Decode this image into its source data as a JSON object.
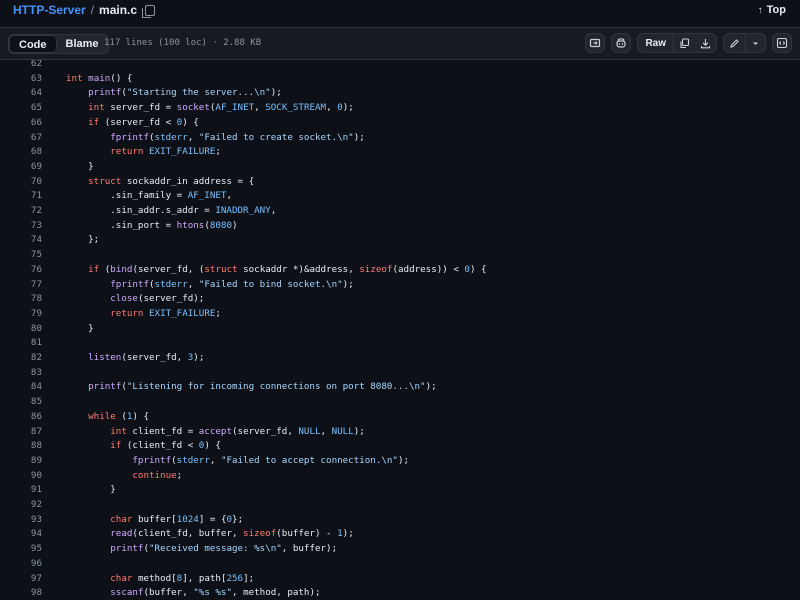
{
  "breadcrumb": {
    "repo": "HTTP-Server",
    "separator": "/",
    "file": "main.c"
  },
  "top_link": "Top",
  "toolbar": {
    "tabs": [
      "Code",
      "Blame"
    ],
    "meta": "117 lines (100 loc) · 2.88 KB",
    "raw_label": "Raw"
  },
  "icons": [
    "copy-icon",
    "arrow-up-icon",
    "open-in-icon",
    "copilot-icon",
    "copy-raw-icon",
    "download-icon",
    "pencil-icon",
    "chevron-down-icon",
    "symbols-panel-icon"
  ],
  "colors": {
    "background": "#0d1117",
    "keyword": "#ff7b72",
    "function": "#d2a8ff",
    "string": "#a5d6ff",
    "constant": "#79c0ff",
    "line_number": "#8b949e",
    "link": "#4493f8"
  },
  "code": {
    "lines": [
      {
        "n": "62",
        "t": ""
      },
      {
        "n": "63",
        "t": "int main() {"
      },
      {
        "n": "64",
        "t": "    printf(\"Starting the server...\\n\");"
      },
      {
        "n": "65",
        "t": "    int server_fd = socket(AF_INET, SOCK_STREAM, 0);"
      },
      {
        "n": "66",
        "t": "    if (server_fd < 0) {"
      },
      {
        "n": "67",
        "t": "        fprintf(stderr, \"Failed to create socket.\\n\");"
      },
      {
        "n": "68",
        "t": "        return EXIT_FAILURE;"
      },
      {
        "n": "69",
        "t": "    }"
      },
      {
        "n": "70",
        "t": "    struct sockaddr_in address = {"
      },
      {
        "n": "71",
        "t": "        .sin_family = AF_INET,"
      },
      {
        "n": "72",
        "t": "        .sin_addr.s_addr = INADDR_ANY,"
      },
      {
        "n": "73",
        "t": "        .sin_port = htons(8080)"
      },
      {
        "n": "74",
        "t": "    };"
      },
      {
        "n": "75",
        "t": ""
      },
      {
        "n": "76",
        "t": "    if (bind(server_fd, (struct sockaddr *)&address, sizeof(address)) < 0) {"
      },
      {
        "n": "77",
        "t": "        fprintf(stderr, \"Failed to bind socket.\\n\");"
      },
      {
        "n": "78",
        "t": "        close(server_fd);"
      },
      {
        "n": "79",
        "t": "        return EXIT_FAILURE;"
      },
      {
        "n": "80",
        "t": "    }"
      },
      {
        "n": "81",
        "t": ""
      },
      {
        "n": "82",
        "t": "    listen(server_fd, 3);"
      },
      {
        "n": "83",
        "t": ""
      },
      {
        "n": "84",
        "t": "    printf(\"Listening for incoming connections on port 8080...\\n\");"
      },
      {
        "n": "85",
        "t": ""
      },
      {
        "n": "86",
        "t": "    while (1) {"
      },
      {
        "n": "87",
        "t": "        int client_fd = accept(server_fd, NULL, NULL);"
      },
      {
        "n": "88",
        "t": "        if (client_fd < 0) {"
      },
      {
        "n": "89",
        "t": "            fprintf(stderr, \"Failed to accept connection.\\n\");"
      },
      {
        "n": "90",
        "t": "            continue;"
      },
      {
        "n": "91",
        "t": "        }"
      },
      {
        "n": "92",
        "t": ""
      },
      {
        "n": "93",
        "t": "        char buffer[1024] = {0};"
      },
      {
        "n": "94",
        "t": "        read(client_fd, buffer, sizeof(buffer) - 1);"
      },
      {
        "n": "95",
        "t": "        printf(\"Received message: %s\\n\", buffer);"
      },
      {
        "n": "96",
        "t": ""
      },
      {
        "n": "97",
        "t": "        char method[8], path[256];"
      },
      {
        "n": "98",
        "t": "        sscanf(buffer, \"%s %s\", method, path);"
      }
    ]
  }
}
